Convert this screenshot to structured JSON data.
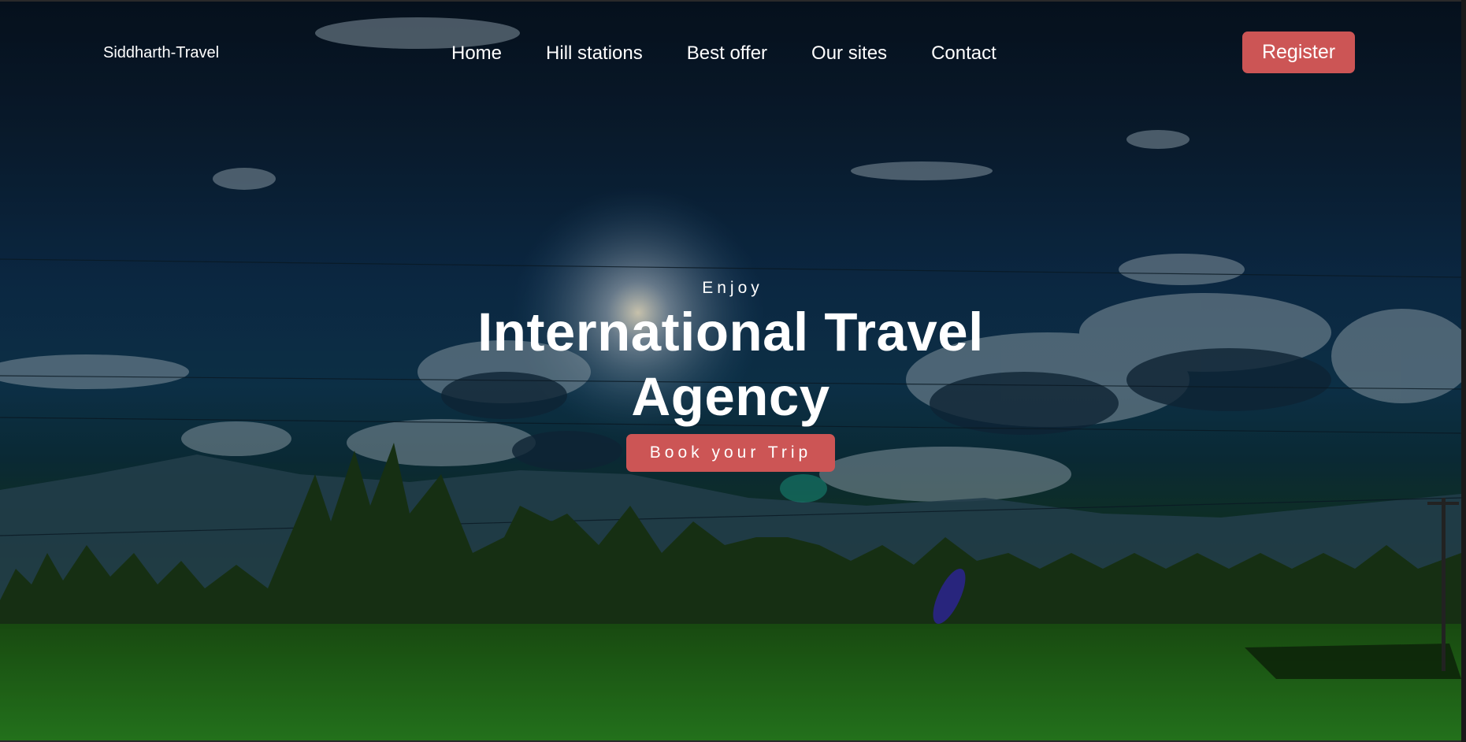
{
  "header": {
    "brand": "Siddharth-Travel",
    "nav": [
      {
        "label": "Home"
      },
      {
        "label": "Hill stations"
      },
      {
        "label": "Best offer"
      },
      {
        "label": "Our sites"
      },
      {
        "label": "Contact"
      }
    ],
    "register_label": "Register"
  },
  "hero": {
    "kicker": "Enjoy",
    "title_line1": "International Travel",
    "title_line2": "Agency",
    "cta_label": "Book your Trip"
  },
  "colors": {
    "accent": "#cc5555",
    "text": "#ffffff"
  }
}
